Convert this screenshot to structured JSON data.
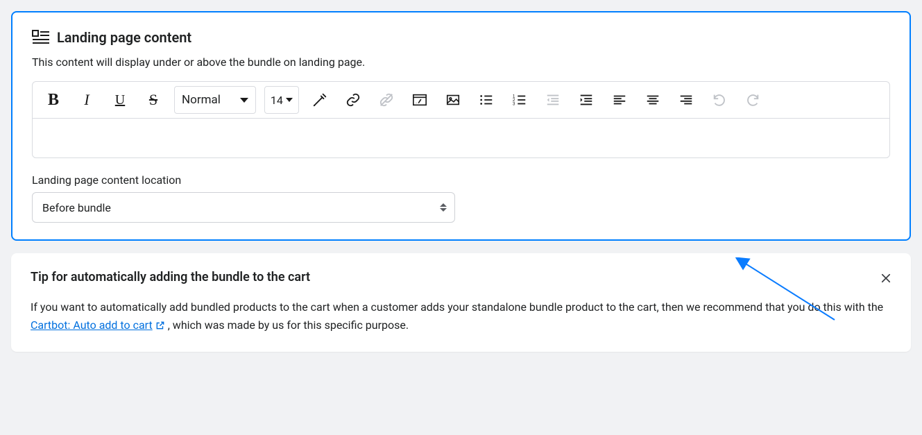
{
  "section": {
    "title": "Landing page content",
    "description": "This content will display under or above the bundle on landing page."
  },
  "editor": {
    "format_label": "Normal",
    "font_size": "14",
    "bold_glyph": "B",
    "italic_glyph": "I",
    "underline_glyph": "U",
    "strike_glyph": "S"
  },
  "location": {
    "label": "Landing page content location",
    "value": "Before bundle"
  },
  "tip": {
    "title": "Tip for automatically adding the bundle to the cart",
    "body_pre": "If you want to automatically add bundled products to the cart when a customer adds your standalone bundle product to the cart, then we recommend that you do this with the ",
    "link_text": "Cartbot: Auto add to cart",
    "body_post": " , which was made by us for this specific purpose."
  }
}
